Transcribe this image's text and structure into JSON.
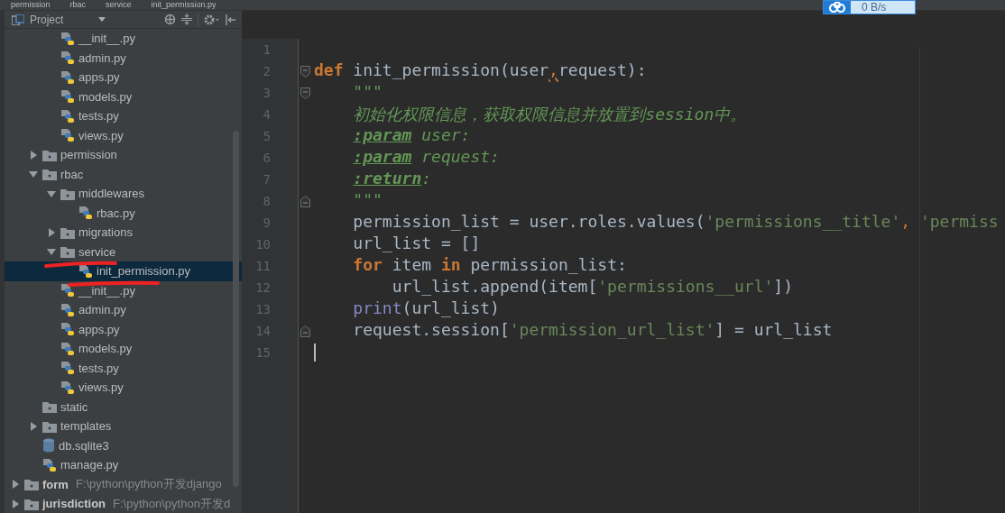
{
  "breadcrumb": [
    "permission",
    "rbac",
    "service",
    "init_permission.py"
  ],
  "network_widget": {
    "speed": "0 B/s"
  },
  "project_panel": {
    "title": "Project",
    "continued_files": [
      {
        "label": "__init__.py",
        "kind": "file",
        "selected": false
      },
      {
        "label": "admin.py",
        "kind": "file",
        "selected": false
      },
      {
        "label": "apps.py",
        "kind": "file",
        "selected": false
      },
      {
        "label": "models.py",
        "kind": "file",
        "selected": false
      },
      {
        "label": "tests.py",
        "kind": "file",
        "selected": false
      },
      {
        "label": "views.py",
        "kind": "file",
        "selected": false
      }
    ],
    "items": [
      {
        "label": "permission",
        "kind": "folder",
        "expanded": false,
        "selected": false
      },
      {
        "label": "rbac",
        "kind": "folder",
        "expanded": true,
        "selected": false,
        "children": [
          {
            "label": "middlewares",
            "kind": "folder",
            "expanded": true,
            "selected": false,
            "children": [
              {
                "label": "rbac.py",
                "kind": "file",
                "selected": false
              }
            ]
          },
          {
            "label": "migrations",
            "kind": "folder",
            "expanded": false,
            "selected": false
          },
          {
            "label": "service",
            "kind": "folder",
            "expanded": true,
            "selected": false,
            "children": [
              {
                "label": "init_permission.py",
                "kind": "file",
                "selected": true
              }
            ]
          },
          {
            "label": "__init__.py",
            "kind": "file",
            "selected": false
          },
          {
            "label": "admin.py",
            "kind": "file",
            "selected": false
          },
          {
            "label": "apps.py",
            "kind": "file",
            "selected": false
          },
          {
            "label": "models.py",
            "kind": "file",
            "selected": false
          },
          {
            "label": "tests.py",
            "kind": "file",
            "selected": false
          },
          {
            "label": "views.py",
            "kind": "file",
            "selected": false
          }
        ]
      },
      {
        "label": "static",
        "kind": "empty-folder",
        "selected": false
      },
      {
        "label": "templates",
        "kind": "folder",
        "expanded": false,
        "selected": false
      },
      {
        "label": "db.sqlite3",
        "kind": "db",
        "selected": false
      },
      {
        "label": "manage.py",
        "kind": "file",
        "selected": false
      }
    ],
    "roots": [
      {
        "label": "form",
        "path": "F:\\python\\python开发django",
        "expanded": false,
        "selected": false
      },
      {
        "label": "jurisdiction",
        "path": "F:\\python\\python开发d",
        "expanded": false,
        "selected": false
      }
    ]
  },
  "editor": {
    "lines": [
      {
        "number": "1",
        "fold_start": false,
        "fold_end": false
      },
      {
        "number": "2",
        "fold_start": true,
        "fold_end": false,
        "tokens": [
          {
            "kind": "keyword",
            "text": "def"
          },
          {
            "kind": "plain",
            "text": " init_permission(user"
          },
          {
            "kind": "warn",
            "text": ","
          },
          {
            "kind": "plain",
            "text": "request):"
          }
        ]
      },
      {
        "number": "3",
        "fold_start": true,
        "fold_end": false,
        "tokens": [
          {
            "kind": "doc",
            "text": "    \"\"\""
          }
        ]
      },
      {
        "number": "4",
        "fold_start": false,
        "fold_end": false,
        "tokens": [
          {
            "kind": "doc",
            "text": "    初始化权限信息，获取权限信息并放置到session中。"
          }
        ]
      },
      {
        "number": "5",
        "fold_start": false,
        "fold_end": false,
        "tokens": [
          {
            "kind": "doctag",
            "text": "    :param"
          },
          {
            "kind": "doc",
            "text": " user:"
          }
        ]
      },
      {
        "number": "6",
        "fold_start": false,
        "fold_end": false,
        "tokens": [
          {
            "kind": "doctag",
            "text": "    :param"
          },
          {
            "kind": "doc",
            "text": " request:"
          }
        ]
      },
      {
        "number": "7",
        "fold_start": false,
        "fold_end": false,
        "tokens": [
          {
            "kind": "doctag",
            "text": "    :return"
          },
          {
            "kind": "doc",
            "text": ":"
          }
        ]
      },
      {
        "number": "8",
        "fold_start": false,
        "fold_end": true,
        "tokens": [
          {
            "kind": "doc",
            "text": "    \"\"\""
          }
        ]
      },
      {
        "number": "9",
        "fold_start": false,
        "fold_end": false,
        "tokens": [
          {
            "kind": "plain",
            "text": "    permission_list = user.roles.values("
          },
          {
            "kind": "string",
            "text": "'permissions__title'"
          },
          {
            "kind": "punct",
            "text": ", "
          },
          {
            "kind": "string",
            "text": "'permiss"
          }
        ]
      },
      {
        "number": "10",
        "fold_start": false,
        "fold_end": false,
        "tokens": [
          {
            "kind": "plain",
            "text": "    url_list = []"
          }
        ]
      },
      {
        "number": "11",
        "fold_start": false,
        "fold_end": false,
        "tokens": [
          {
            "kind": "keyword",
            "text": "    for"
          },
          {
            "kind": "plain",
            "text": " item "
          },
          {
            "kind": "keyword",
            "text": "in"
          },
          {
            "kind": "plain",
            "text": " permission_list:"
          }
        ]
      },
      {
        "number": "12",
        "fold_start": false,
        "fold_end": false,
        "tokens": [
          {
            "kind": "plain",
            "text": "        url_list.append(item["
          },
          {
            "kind": "string",
            "text": "'permissions__url'"
          },
          {
            "kind": "plain",
            "text": "])"
          }
        ]
      },
      {
        "number": "13",
        "fold_start": false,
        "fold_end": false,
        "tokens": [
          {
            "kind": "builtin",
            "text": "    print"
          },
          {
            "kind": "plain",
            "text": "(url_list)"
          }
        ]
      },
      {
        "number": "14",
        "fold_start": false,
        "fold_end": true,
        "tokens": [
          {
            "kind": "plain",
            "text": "    request.session["
          },
          {
            "kind": "string",
            "text": "'permission_url_list'"
          },
          {
            "kind": "plain",
            "text": "] = url_list"
          }
        ]
      },
      {
        "number": "15",
        "caret": true,
        "fold_start": false,
        "fold_end": false
      }
    ]
  }
}
